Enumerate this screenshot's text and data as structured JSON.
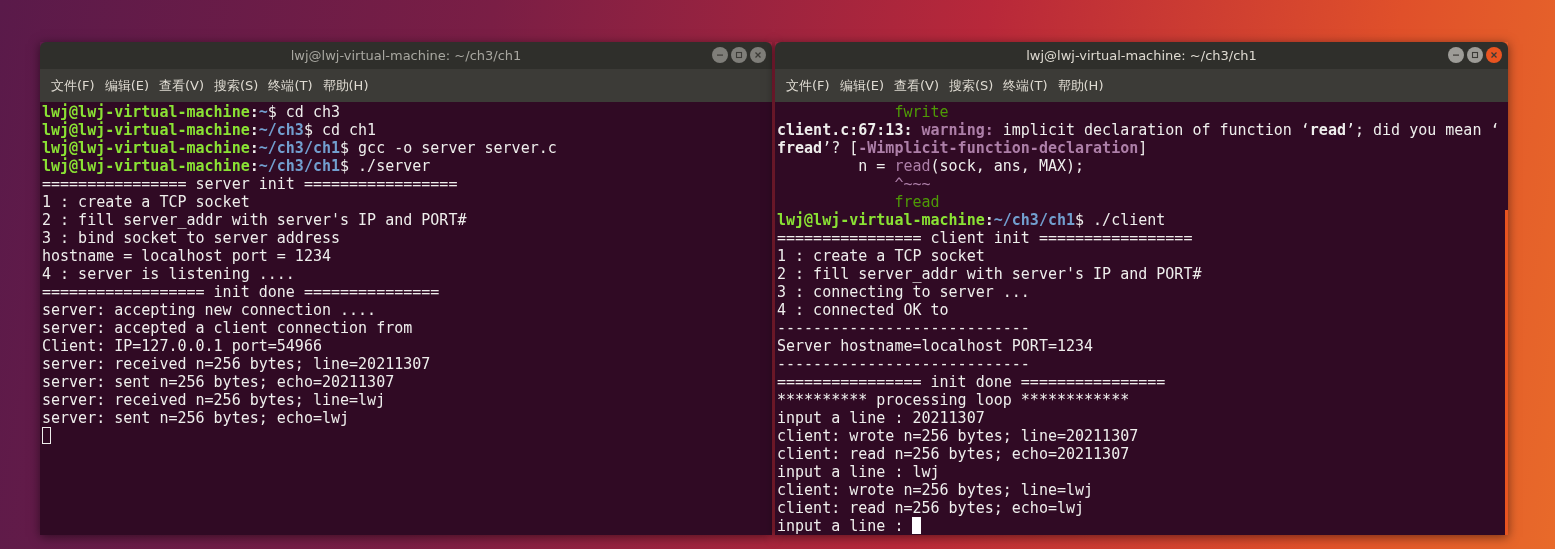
{
  "windows": [
    {
      "title": "lwj@lwj-virtual-machine: ~/ch3/ch1",
      "active": false,
      "menu": [
        "文件(F)",
        "编辑(E)",
        "查看(V)",
        "搜索(S)",
        "终端(T)",
        "帮助(H)"
      ],
      "lines": [
        [
          {
            "kind": "user",
            "text": "lwj@lwj-virtual-machine"
          },
          {
            "kind": "bold",
            "text": ":"
          },
          {
            "kind": "path",
            "text": "~"
          },
          {
            "kind": "plain",
            "text": "$ cd ch3"
          }
        ],
        [
          {
            "kind": "user",
            "text": "lwj@lwj-virtual-machine"
          },
          {
            "kind": "bold",
            "text": ":"
          },
          {
            "kind": "path",
            "text": "~/ch3"
          },
          {
            "kind": "plain",
            "text": "$ cd ch1"
          }
        ],
        [
          {
            "kind": "user",
            "text": "lwj@lwj-virtual-machine"
          },
          {
            "kind": "bold",
            "text": ":"
          },
          {
            "kind": "path",
            "text": "~/ch3/ch1"
          },
          {
            "kind": "plain",
            "text": "$ gcc -o server server.c"
          }
        ],
        [
          {
            "kind": "user",
            "text": "lwj@lwj-virtual-machine"
          },
          {
            "kind": "bold",
            "text": ":"
          },
          {
            "kind": "path",
            "text": "~/ch3/ch1"
          },
          {
            "kind": "plain",
            "text": "$ ./server"
          }
        ],
        [
          {
            "kind": "plain",
            "text": "================ server init ================="
          }
        ],
        [
          {
            "kind": "plain",
            "text": "1 : create a TCP socket"
          }
        ],
        [
          {
            "kind": "plain",
            "text": "2 : fill server_addr with server's IP and PORT#"
          }
        ],
        [
          {
            "kind": "plain",
            "text": "3 : bind socket to server address"
          }
        ],
        [
          {
            "kind": "plain",
            "text": "hostname = localhost port = 1234"
          }
        ],
        [
          {
            "kind": "plain",
            "text": "4 : server is listening ...."
          }
        ],
        [
          {
            "kind": "plain",
            "text": "================== init done ==============="
          }
        ],
        [
          {
            "kind": "plain",
            "text": "server: accepting new connection ...."
          }
        ],
        [
          {
            "kind": "plain",
            "text": "server: accepted a client connection from"
          }
        ],
        [
          {
            "kind": "plain",
            "text": "Client: IP=127.0.0.1 port=54966"
          }
        ],
        [
          {
            "kind": "plain",
            "text": "server: received n=256 bytes; line=20211307"
          }
        ],
        [
          {
            "kind": "plain",
            "text": "server: sent n=256 bytes; echo=20211307"
          }
        ],
        [
          {
            "kind": "plain",
            "text": "server: received n=256 bytes; line=lwj"
          }
        ],
        [
          {
            "kind": "plain",
            "text": "server: sent n=256 bytes; echo=lwj"
          }
        ]
      ],
      "cursor": {
        "filled": false
      }
    },
    {
      "title": "lwj@lwj-virtual-machine: ~/ch3/ch1",
      "active": true,
      "menu": [
        "文件(F)",
        "编辑(E)",
        "查看(V)",
        "搜索(S)",
        "终端(T)",
        "帮助(H)"
      ],
      "lines": [
        [
          {
            "kind": "hint",
            "text": "             fwrite"
          }
        ],
        [
          {
            "kind": "bold",
            "text": "client.c:67:13: "
          },
          {
            "kind": "warning",
            "text": "warning: "
          },
          {
            "kind": "plain",
            "text": "implicit declaration of function ‘"
          },
          {
            "kind": "bold",
            "text": "read"
          },
          {
            "kind": "plain",
            "text": "’; did you mean ‘"
          }
        ],
        [
          {
            "kind": "bold",
            "text": "fread"
          },
          {
            "kind": "plain",
            "text": "’? ["
          },
          {
            "kind": "flag",
            "text": "-Wimplicit-function-declaration"
          },
          {
            "kind": "plain",
            "text": "]"
          }
        ],
        [
          {
            "kind": "plain",
            "text": "         n = "
          },
          {
            "kind": "call",
            "text": "read"
          },
          {
            "kind": "plain",
            "text": "(sock, ans, MAX);"
          }
        ],
        [
          {
            "kind": "caret",
            "text": "             ^~~~"
          }
        ],
        [
          {
            "kind": "hint",
            "text": "             fread"
          }
        ],
        [
          {
            "kind": "user",
            "text": "lwj@lwj-virtual-machine"
          },
          {
            "kind": "bold",
            "text": ":"
          },
          {
            "kind": "path",
            "text": "~/ch3/ch1"
          },
          {
            "kind": "plain",
            "text": "$ ./client"
          }
        ],
        [
          {
            "kind": "plain",
            "text": "================ client init ================="
          }
        ],
        [
          {
            "kind": "plain",
            "text": "1 : create a TCP socket"
          }
        ],
        [
          {
            "kind": "plain",
            "text": "2 : fill server_addr with server's IP and PORT#"
          }
        ],
        [
          {
            "kind": "plain",
            "text": "3 : connecting to server ..."
          }
        ],
        [
          {
            "kind": "plain",
            "text": "4 : connected OK to"
          }
        ],
        [
          {
            "kind": "plain",
            "text": "----------------------------"
          }
        ],
        [
          {
            "kind": "plain",
            "text": "Server hostname=localhost PORT=1234"
          }
        ],
        [
          {
            "kind": "plain",
            "text": "----------------------------"
          }
        ],
        [
          {
            "kind": "plain",
            "text": "================ init done ================"
          }
        ],
        [
          {
            "kind": "plain",
            "text": "********** processing loop ************"
          }
        ],
        [
          {
            "kind": "plain",
            "text": "input a line : 20211307"
          }
        ],
        [
          {
            "kind": "plain",
            "text": "client: wrote n=256 bytes; line=20211307"
          }
        ],
        [
          {
            "kind": "plain",
            "text": "client: read n=256 bytes; echo=20211307"
          }
        ],
        [
          {
            "kind": "plain",
            "text": "input a line : lwj"
          }
        ],
        [
          {
            "kind": "plain",
            "text": "client: wrote n=256 bytes; line=lwj"
          }
        ],
        [
          {
            "kind": "plain",
            "text": "client: read n=256 bytes; echo=lwj"
          }
        ],
        [
          {
            "kind": "plain",
            "text": "input a line : "
          }
        ]
      ],
      "cursor": {
        "filled": true
      }
    }
  ]
}
